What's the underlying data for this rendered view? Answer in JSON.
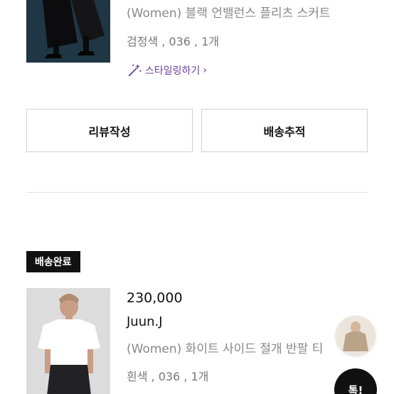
{
  "order_item_1": {
    "product_name": "(Women) 블랙 언밸런스 플리츠 스커트",
    "options": "검정색 , 036 , 1개",
    "styling_link": "스타일링하기",
    "styling_icon": "magic-wand-icon",
    "chevron": "›"
  },
  "actions": {
    "review_label": "리뷰작성",
    "track_label": "배송추적"
  },
  "order_item_2": {
    "status_badge": "배송완료",
    "price": "230,000",
    "brand": "Juun.J",
    "product_name": "(Women) 화이트 사이드 절개 반팔 티",
    "options": "흰색 , 036 , 1개"
  },
  "floating": {
    "button_label": "톡!"
  },
  "colors": {
    "accent_purple": "#6b3fa0",
    "badge_bg": "#111111",
    "border": "#d0d0d0"
  }
}
